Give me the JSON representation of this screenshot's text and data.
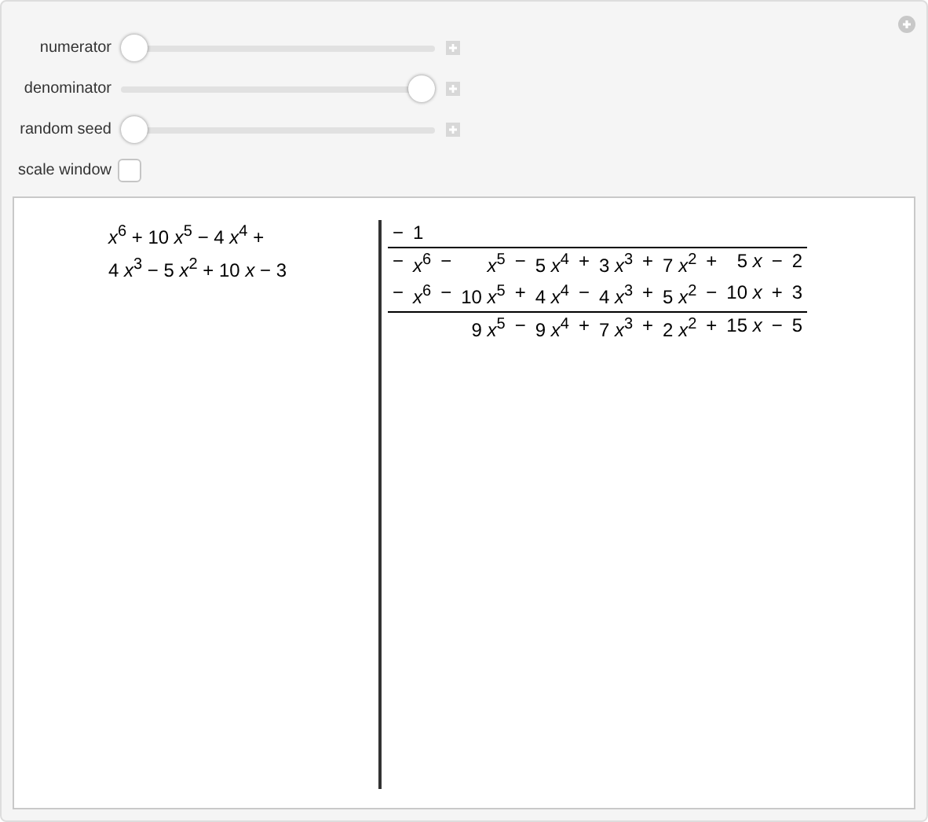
{
  "controls": [
    {
      "kind": "slider",
      "label": "numerator",
      "level": 0
    },
    {
      "kind": "slider",
      "label": "denominator",
      "level": 1
    },
    {
      "kind": "slider",
      "label": "random seed",
      "level": 0
    },
    {
      "kind": "checkbox",
      "label": "scale window",
      "checked": false
    }
  ],
  "output": {
    "polynomial_lines": [
      "*x*$^{6}$ + 10 *x*$^{5}$ − 4 *x*$^{4}$ +",
      "4 *x*$^{3}$ − 5 *x*$^{2}$ + 10 *x* − 3"
    ],
    "division_rows": [
      {
        "kind": "quotient",
        "cells": [
          "−",
          "1"
        ]
      },
      {
        "kind": "rule"
      },
      {
        "kind": "term",
        "cells": [
          "−",
          "*x*$^{6}$",
          "−",
          "*x*$^{5}$",
          "−",
          "5 *x*$^{4}$",
          "+",
          "3 *x*$^{3}$",
          "+",
          "7 *x*$^{2}$",
          "+",
          "5 *x*",
          "−",
          "2"
        ]
      },
      {
        "kind": "term",
        "cells": [
          "−",
          "*x*$^{6}$",
          "−",
          "10 *x*$^{5}$",
          "+",
          "4 *x*$^{4}$",
          "−",
          "4 *x*$^{3}$",
          "+",
          "5 *x*$^{2}$",
          "−",
          "10 *x*",
          "+",
          "3"
        ]
      },
      {
        "kind": "rule"
      },
      {
        "kind": "term",
        "cells": [
          "9 *x*$^{5}$",
          "−",
          "9 *x*$^{4}$",
          "+",
          "7 *x*$^{3}$",
          "+",
          "2 *x*$^{2}$",
          "+",
          "15 *x*",
          "−",
          "5"
        ]
      }
    ]
  }
}
